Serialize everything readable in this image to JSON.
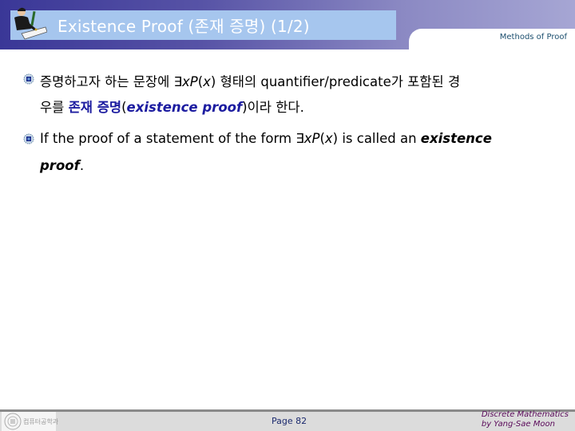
{
  "header": {
    "title": "Existence Proof  (존재 증명) (1/2)",
    "section": "Methods of Proof",
    "icon": "presenter-writing-icon"
  },
  "bullets": [
    {
      "icon": "bullet-icon",
      "line1": {
        "pre": "증명하고자 하는 문장에 ",
        "exists": "∃",
        "x": "x",
        "P": "P",
        "paren_open": "(",
        "x2": "x",
        "paren_close": ")",
        "post1": " 형태의 ",
        "qp": "quantifier/predicate",
        "post2": "가 포함된 경"
      },
      "line2": {
        "pre": "우를 ",
        "term_kr": "존재 증명",
        "paren_open": "(",
        "term_en": "existence proof",
        "paren_close": ")",
        "post": "이라 한다."
      }
    },
    {
      "icon": "bullet-icon",
      "line1": {
        "pre": "If the proof of a statement of the form ",
        "exists": "∃",
        "x": "x",
        "P": "P",
        "paren_open": "(",
        "x2": "x",
        "paren_close": ")",
        "post": " is called an ",
        "term": "existence"
      },
      "line2": {
        "term": "proof",
        "post": "."
      }
    }
  ],
  "footer": {
    "logo_text": "컴퓨터공학과",
    "page": "Page 82",
    "credit_line1": "Discrete Mathematics",
    "credit_line2": "by Yang-Sae Moon"
  }
}
